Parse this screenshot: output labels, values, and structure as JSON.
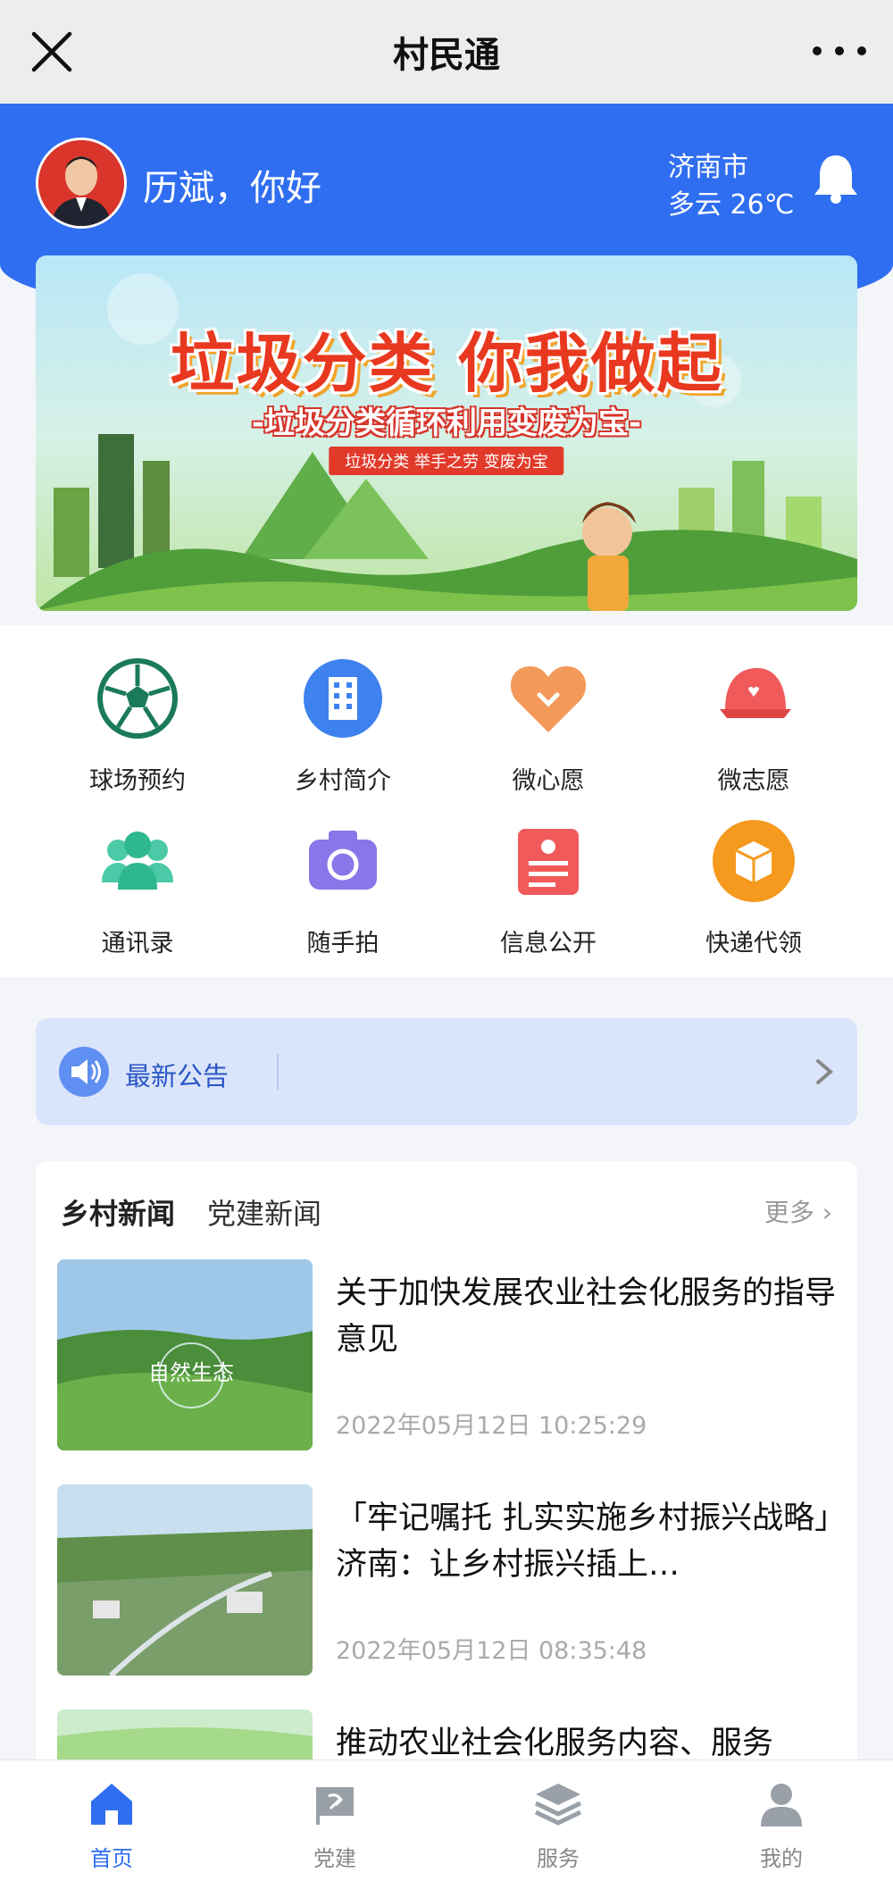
{
  "titlebar": {
    "title": "村民通"
  },
  "header": {
    "greeting": "历斌，你好",
    "city": "济南市",
    "weather": "多云 26℃"
  },
  "banner": {
    "headline": "垃圾分类 你我做起",
    "subline": "-垃圾分类循环利用变废为宝-",
    "tagline": "垃圾分类 举手之劳 变废为宝"
  },
  "grid": [
    {
      "label": "球场预约",
      "icon": "soccer-ball-icon"
    },
    {
      "label": "乡村简介",
      "icon": "building-icon"
    },
    {
      "label": "微心愿",
      "icon": "heart-icon"
    },
    {
      "label": "微志愿",
      "icon": "cap-icon"
    },
    {
      "label": "通讯录",
      "icon": "contacts-icon"
    },
    {
      "label": "随手拍",
      "icon": "camera-icon"
    },
    {
      "label": "信息公开",
      "icon": "document-icon"
    },
    {
      "label": "快递代领",
      "icon": "package-icon"
    }
  ],
  "notice": {
    "label": "最新公告"
  },
  "news": {
    "tabs": [
      "乡村新闻",
      "党建新闻"
    ],
    "more": "更多",
    "items": [
      {
        "title": "关于加快发展农业社会化服务的指导意见",
        "time": "2022年05月12日 10:25:29",
        "thumb_text": "自然生态"
      },
      {
        "title": "「牢记嘱托 扎实实施乡村振兴战略」济南：让乡村振兴插上…",
        "time": "2022年05月12日 08:35:48"
      },
      {
        "title": "推动农业社会化服务内容、服务",
        "time": ""
      }
    ]
  },
  "tabbar": [
    {
      "label": "首页",
      "icon": "home-icon",
      "active": true
    },
    {
      "label": "党建",
      "icon": "party-flag-icon",
      "active": false
    },
    {
      "label": "服务",
      "icon": "layers-icon",
      "active": false
    },
    {
      "label": "我的",
      "icon": "user-icon",
      "active": false
    }
  ],
  "colors": {
    "primary": "#2f6ef0",
    "notice_bg": "#dae5fb",
    "bg": "#f4f5f9"
  }
}
